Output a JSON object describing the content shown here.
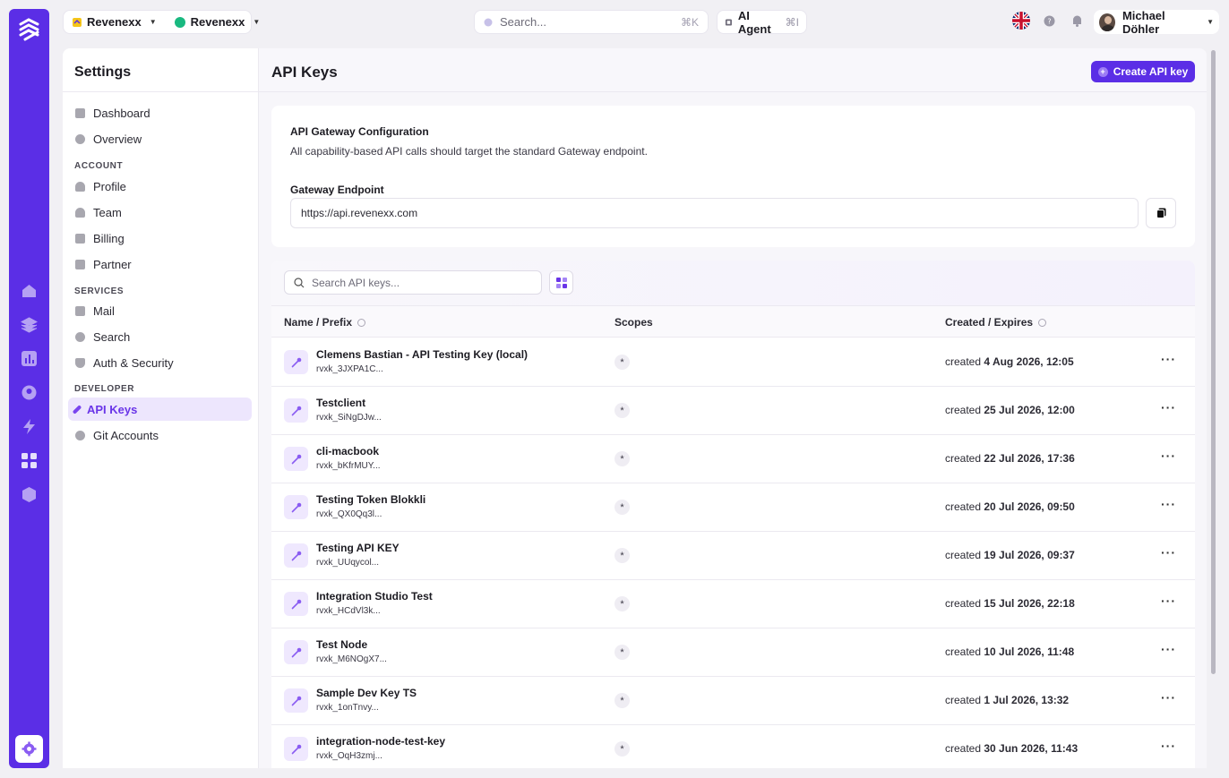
{
  "colors": {
    "accent": "#5b2ee6",
    "active_bg": "#ede6fd",
    "active_text": "#6a35e8"
  },
  "topbar": {
    "org_name": "Revenexx",
    "project_name": "Revenexx",
    "search_placeholder": "Search...",
    "search_shortcut": "⌘K",
    "ai_agent_label": "AI Agent",
    "ai_agent_shortcut": "⌘I",
    "user_name": "Michael Döhler",
    "icons": [
      "uk-flag-icon",
      "help-icon",
      "bell-icon"
    ]
  },
  "sidebar": {
    "title": "Settings",
    "items_top": [
      {
        "label": "Dashboard",
        "icon": "dashboard-icon"
      },
      {
        "label": "Overview",
        "icon": "overview-icon"
      }
    ],
    "sections": [
      {
        "heading": "ACCOUNT",
        "items": [
          {
            "label": "Profile",
            "icon": "user-icon"
          },
          {
            "label": "Team",
            "icon": "team-icon"
          },
          {
            "label": "Billing",
            "icon": "billing-icon"
          },
          {
            "label": "Partner",
            "icon": "partner-icon"
          }
        ]
      },
      {
        "heading": "SERVICES",
        "items": [
          {
            "label": "Mail",
            "icon": "mail-icon"
          },
          {
            "label": "Search",
            "icon": "search-icon"
          },
          {
            "label": "Auth & Security",
            "icon": "shield-icon"
          }
        ]
      },
      {
        "heading": "DEVELOPER",
        "items": [
          {
            "label": "API Keys",
            "icon": "key-icon",
            "active": true
          },
          {
            "label": "Git Accounts",
            "icon": "git-icon"
          }
        ]
      }
    ]
  },
  "main": {
    "title": "API Keys",
    "create_button": "Create API key",
    "gateway": {
      "title": "API Gateway Configuration",
      "description": "All capability-based API calls should target the standard Gateway endpoint.",
      "endpoint_label": "Gateway Endpoint",
      "endpoint_value": "https://api.revenexx.com"
    },
    "table": {
      "search_placeholder": "Search API keys...",
      "columns": [
        "Name / Prefix",
        "Scopes",
        "Created / Expires"
      ],
      "created_prefix": "created",
      "rows": [
        {
          "name": "Clemens Bastian - API Testing Key (local)",
          "prefix": "rvxk_3JXPA1C...",
          "scope": "*",
          "created": "4 Aug 2026, 12:05"
        },
        {
          "name": "Testclient",
          "prefix": "rvxk_SiNgDJw...",
          "scope": "*",
          "created": "25 Jul 2026, 12:00"
        },
        {
          "name": "cli-macbook",
          "prefix": "rvxk_bKfrMUY...",
          "scope": "*",
          "created": "22 Jul 2026, 17:36"
        },
        {
          "name": "Testing Token Blokkli",
          "prefix": "rvxk_QX0Qq3l...",
          "scope": "*",
          "created": "20 Jul 2026, 09:50"
        },
        {
          "name": "Testing API KEY",
          "prefix": "rvxk_UUqycol...",
          "scope": "*",
          "created": "19 Jul 2026, 09:37"
        },
        {
          "name": "Integration Studio Test",
          "prefix": "rvxk_HCdVl3k...",
          "scope": "*",
          "created": "15 Jul 2026, 22:18"
        },
        {
          "name": "Test Node",
          "prefix": "rvxk_M6NOgX7...",
          "scope": "*",
          "created": "10 Jul 2026, 11:48"
        },
        {
          "name": "Sample Dev Key TS",
          "prefix": "rvxk_1onTnvy...",
          "scope": "*",
          "created": "1 Jul 2026, 13:32"
        },
        {
          "name": "integration-node-test-key",
          "prefix": "rvxk_OqH3zmj...",
          "scope": "*",
          "created": "30 Jun 2026, 11:43"
        }
      ]
    }
  }
}
